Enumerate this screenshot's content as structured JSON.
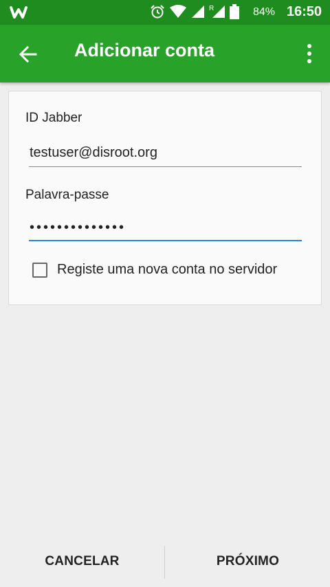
{
  "status_bar": {
    "app_icon": "w-logo-icon",
    "icons": [
      "alarm-icon",
      "wifi-icon",
      "signal-icon",
      "roaming-signal-icon",
      "battery-icon"
    ],
    "roaming_label": "R",
    "battery_percent": "84%",
    "time": "16:50"
  },
  "app_bar": {
    "title": "Adicionar conta",
    "back_icon": "arrow-back-icon",
    "menu_icon": "more-vert-icon",
    "color": "#28a228"
  },
  "form": {
    "jabber_label": "ID Jabber",
    "jabber_value": "testuser@disroot.org",
    "password_label": "Palavra-passe",
    "password_value": "••••••••••••••",
    "focus_color": "#1e88e5",
    "register_checkbox": {
      "label": "Registe uma nova conta no servidor",
      "checked": false
    }
  },
  "footer": {
    "cancel_label": "CANCELAR",
    "next_label": "PRÓXIMO"
  }
}
